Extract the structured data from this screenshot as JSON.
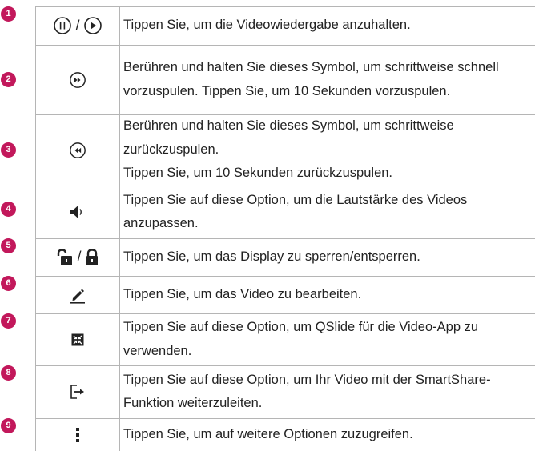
{
  "rows": [
    {
      "number": "1",
      "icon_name": "pause-play-icon",
      "text": "Tippen Sie, um die Videowiedergabe anzuhalten."
    },
    {
      "number": "2",
      "icon_name": "fast-forward-icon",
      "text": "Berühren und halten Sie dieses Symbol, um schrittweise schnell vorzuspulen. Tippen Sie, um 10 Sekunden vorzuspulen."
    },
    {
      "number": "3",
      "icon_name": "rewind-icon",
      "text": "Berühren und halten Sie dieses Symbol, um schrittweise zurückzuspulen.",
      "text_extra": "Tippen Sie, um 10 Sekunden zurückzuspulen."
    },
    {
      "number": "4",
      "icon_name": "volume-icon",
      "text": "Tippen Sie auf diese Option, um die Lautstärke des Videos anzupassen."
    },
    {
      "number": "5",
      "icon_name": "unlock-lock-icon",
      "text": "Tippen Sie, um das Display zu sperren/entsperren."
    },
    {
      "number": "6",
      "icon_name": "edit-pencil-icon",
      "text": "Tippen Sie, um das Video zu bearbeiten."
    },
    {
      "number": "7",
      "icon_name": "qslide-icon",
      "text": "Tippen Sie auf diese Option, um QSlide für die Video-App zu verwenden."
    },
    {
      "number": "8",
      "icon_name": "share-icon",
      "text": "Tippen Sie auf diese Option, um Ihr Video mit der SmartShare-Funktion weiterzuleiten."
    },
    {
      "number": "9",
      "icon_name": "more-options-icon",
      "text": "Tippen Sie, um auf weitere Optionen zuzugreifen."
    }
  ],
  "separator": "/",
  "colors": {
    "badge": "#c2185b",
    "lines": "#b5b5b5",
    "text": "#222222"
  }
}
